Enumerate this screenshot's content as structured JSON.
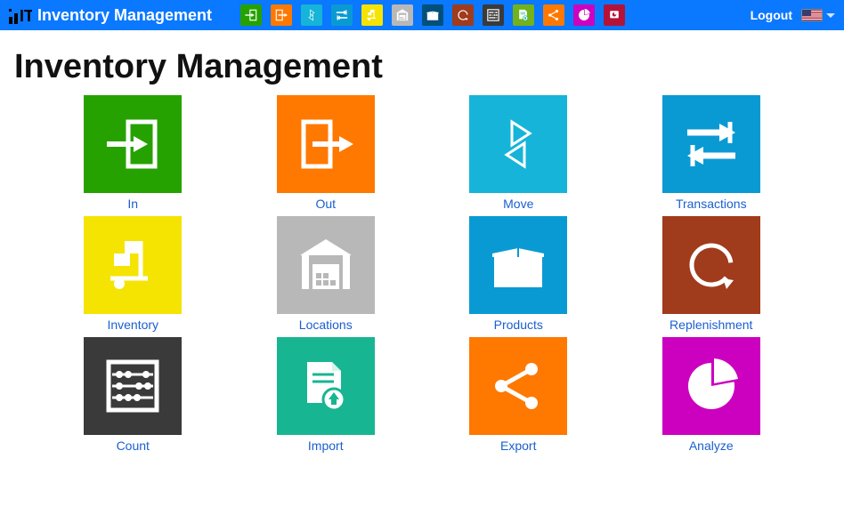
{
  "header": {
    "app_title": "Inventory Management",
    "logout_label": "Logout"
  },
  "page": {
    "title": "Inventory Management"
  },
  "toolbar": [
    {
      "icon": "in-icon",
      "bg": "bg-green"
    },
    {
      "icon": "out-icon",
      "bg": "bg-orange"
    },
    {
      "icon": "move-icon",
      "bg": "bg-cyan"
    },
    {
      "icon": "transactions-icon",
      "bg": "bg-blue"
    },
    {
      "icon": "inventory-icon",
      "bg": "bg-yellow"
    },
    {
      "icon": "locations-icon",
      "bg": "bg-gray"
    },
    {
      "icon": "products-icon",
      "bg": "bg-darkblue"
    },
    {
      "icon": "replenishment-icon",
      "bg": "bg-brown"
    },
    {
      "icon": "count-icon",
      "bg": "bg-dark"
    },
    {
      "icon": "import-icon",
      "bg": "bg-grass"
    },
    {
      "icon": "export-icon",
      "bg": "bg-orange"
    },
    {
      "icon": "analyze-icon",
      "bg": "bg-magenta"
    },
    {
      "icon": "reports-icon",
      "bg": "bg-crimson"
    }
  ],
  "tiles": [
    {
      "label": "In",
      "icon": "in-icon",
      "bg": "bg-green"
    },
    {
      "label": "Out",
      "icon": "out-icon",
      "bg": "bg-orange"
    },
    {
      "label": "Move",
      "icon": "move-icon",
      "bg": "bg-cyan"
    },
    {
      "label": "Transactions",
      "icon": "transactions-icon",
      "bg": "bg-blue"
    },
    {
      "label": "Inventory",
      "icon": "inventory-icon",
      "bg": "bg-yellow"
    },
    {
      "label": "Locations",
      "icon": "locations-icon",
      "bg": "bg-gray"
    },
    {
      "label": "Products",
      "icon": "products-icon",
      "bg": "bg-blue"
    },
    {
      "label": "Replenishment",
      "icon": "replenishment-icon",
      "bg": "bg-brown"
    },
    {
      "label": "Count",
      "icon": "count-icon",
      "bg": "bg-dark"
    },
    {
      "label": "Import",
      "icon": "import-icon",
      "bg": "bg-teal"
    },
    {
      "label": "Export",
      "icon": "export-icon",
      "bg": "bg-orange"
    },
    {
      "label": "Analyze",
      "icon": "analyze-icon",
      "bg": "bg-magenta"
    }
  ]
}
